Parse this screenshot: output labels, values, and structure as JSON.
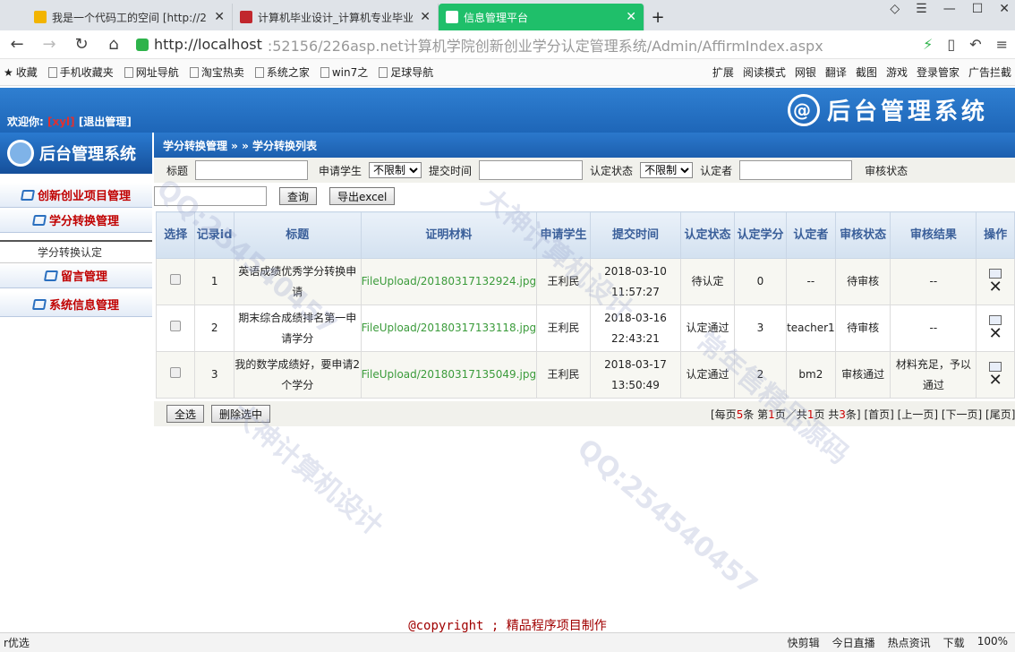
{
  "browser": {
    "tabs": [
      {
        "title": "我是一个代码工的空间 [http://2",
        "active": false
      },
      {
        "title": "计算机毕业设计_计算机专业毕业",
        "active": false
      },
      {
        "title": "信息管理平台",
        "active": true
      }
    ],
    "new_tab": "+",
    "url_host": "http://localhost",
    "url_rest": ":52156/226asp.net计算机学院创新创业学分认定管理系统/Admin/AffirmIndex.aspx",
    "bookmarks": [
      "收藏",
      "手机收藏夹",
      "网址导航",
      "淘宝热卖",
      "系统之家",
      "win7之",
      "足球导航"
    ],
    "bookmarks_right": [
      "扩展",
      "阅读模式",
      "网银",
      "翻译",
      "截图",
      "游戏",
      "登录管家",
      "广告拦截"
    ]
  },
  "header": {
    "welcome_label": "欢迎你:",
    "username": "[xyl]",
    "logout": "[退出管理]",
    "brand": "后台管理系统"
  },
  "sidebar": {
    "logo_text": "后台管理系统",
    "items": [
      {
        "label": "创新创业项目管理"
      },
      {
        "label": "学分转换管理"
      },
      {
        "label": "学分转换认定"
      },
      {
        "label": "留言管理"
      },
      {
        "label": "系统信息管理"
      }
    ]
  },
  "breadcrumb": "学分转换管理 » » 学分转换列表",
  "filters": {
    "title_label": "标题",
    "applicant_label": "申请学生",
    "applicant_value": "不限制",
    "submit_time_label": "提交时间",
    "status_label": "认定状态",
    "status_value": "不限制",
    "approver_label": "认定者",
    "review_label": "审核状态"
  },
  "actions": {
    "query": "查询",
    "export": "导出excel"
  },
  "table": {
    "headers": [
      "选择",
      "记录id",
      "标题",
      "证明材料",
      "申请学生",
      "提交时间",
      "认定状态",
      "认定学分",
      "认定者",
      "审核状态",
      "审核结果",
      "操作"
    ],
    "rows": [
      {
        "id": "1",
        "title": "英语成绩优秀学分转换申请",
        "file": "FileUpload/20180317132924.jpg",
        "student": "王利民",
        "time": "2018-03-10 11:57:27",
        "status": "待认定",
        "credit": "0",
        "approver": "--",
        "review": "待审核",
        "result": "--"
      },
      {
        "id": "2",
        "title": "期末综合成绩排名第一申请学分",
        "file": "FileUpload/20180317133118.jpg",
        "student": "王利民",
        "time": "2018-03-16 22:43:21",
        "status": "认定通过",
        "credit": "3",
        "approver": "teacher1",
        "review": "待审核",
        "result": "--"
      },
      {
        "id": "3",
        "title": "我的数学成绩好，要申请2个学分",
        "file": "FileUpload/20180317135049.jpg",
        "student": "王利民",
        "time": "2018-03-17 13:50:49",
        "status": "认定通过",
        "credit": "2",
        "approver": "bm2",
        "review": "审核通过",
        "result": "材料充足，予以通过"
      }
    ]
  },
  "footer": {
    "select_all": "全选",
    "delete_selected": "删除选中",
    "pager_a": "[每页",
    "per_page": "5",
    "pager_b": "条 第",
    "page": "1",
    "pager_c": "页／共",
    "total_pages": "1",
    "pager_d": "页 共",
    "total": "3",
    "pager_e": "条]",
    "first": "[首页]",
    "prev": "[上一页]",
    "next": "[下一页]",
    "last": "[尾页]"
  },
  "copyright": "@copyright ; 精品程序项目制作",
  "statusbar": {
    "left": "r优选",
    "items": [
      "快剪辑",
      "今日直播",
      "热点资讯",
      "下载",
      "100%"
    ]
  },
  "watermarks": [
    "大神计算机设计",
    "QQ:254540457",
    "常年售精品源码"
  ]
}
